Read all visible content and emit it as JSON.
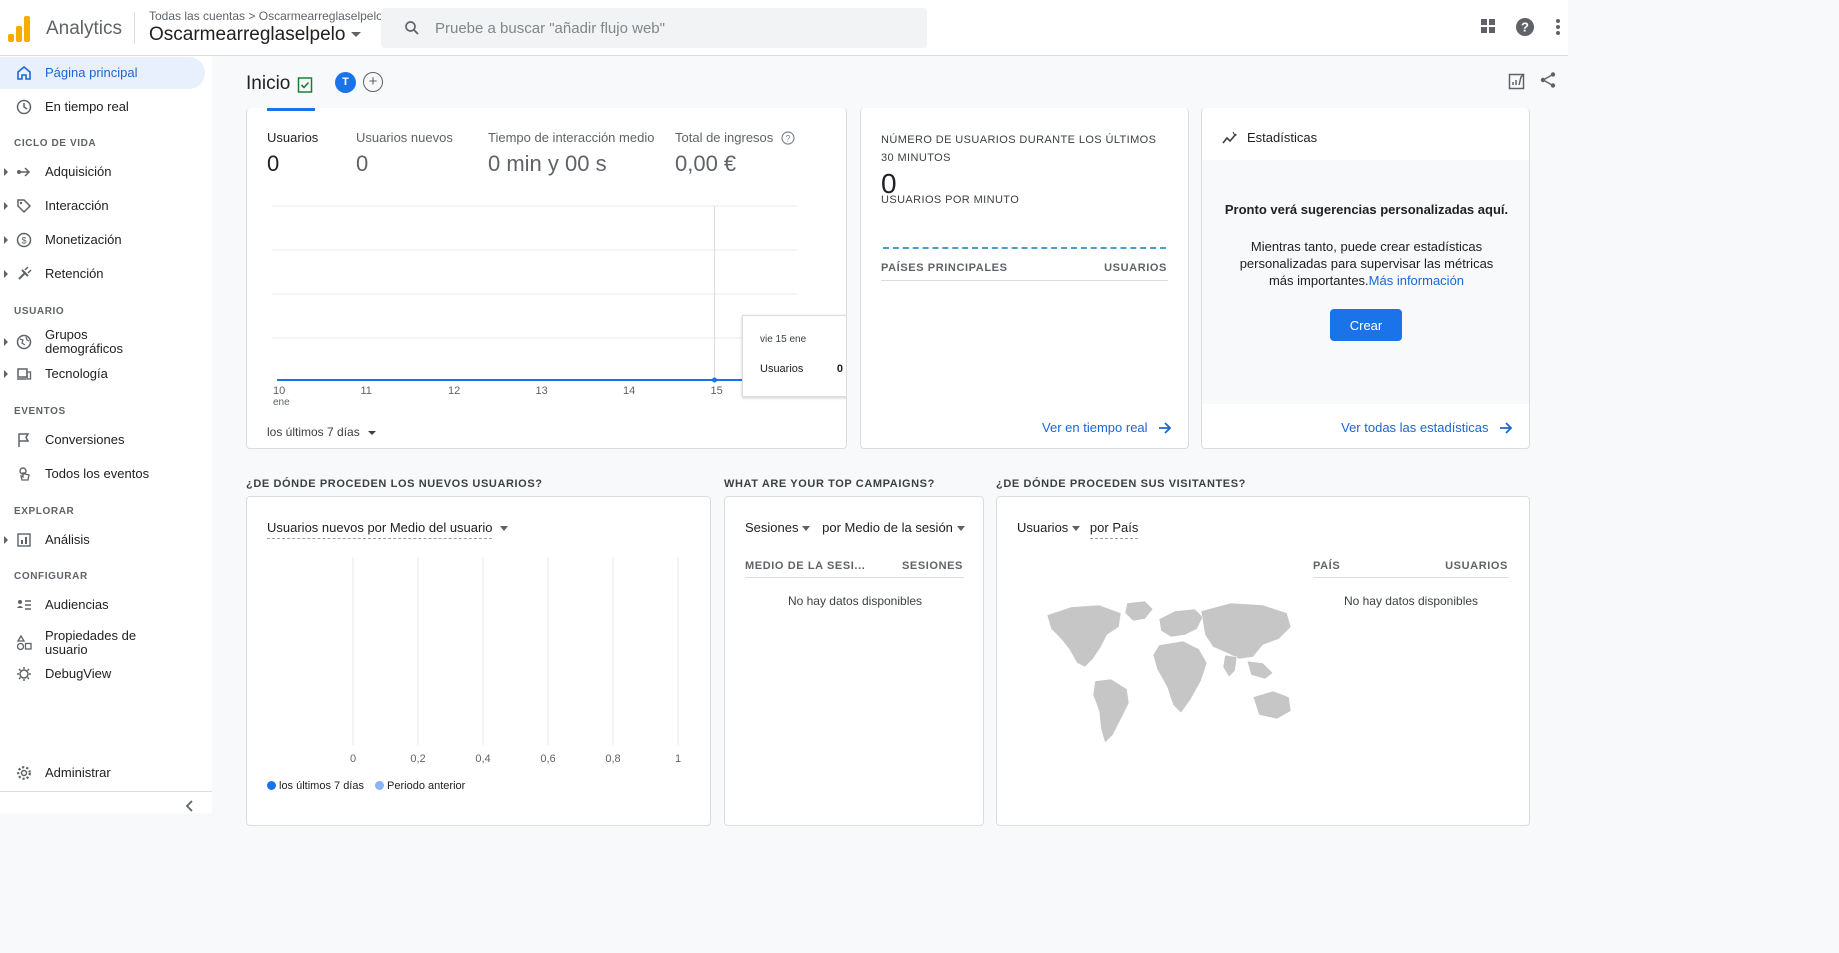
{
  "header": {
    "brand": "Analytics",
    "breadcrumb_root": "Todas las cuentas",
    "breadcrumb_sep": ">",
    "breadcrumb_account": "Oscarmearreglaselpelo",
    "property": "Oscarmearreglaselpelo",
    "search_placeholder": "Pruebe a buscar \"añadir flujo web\"",
    "logo_color": "#f9ab00"
  },
  "sidebar": {
    "top": [
      {
        "label": "Página principal",
        "icon": "home-icon",
        "active": true
      },
      {
        "label": "En tiempo real",
        "icon": "clock-icon"
      }
    ],
    "sections": [
      {
        "title": "CICLO DE VIDA",
        "items": [
          "Adquisición",
          "Interacción",
          "Monetización",
          "Retención"
        ]
      },
      {
        "title": "USUARIO",
        "items": [
          "Grupos demográficos",
          "Tecnología"
        ]
      },
      {
        "title": "EVENTOS",
        "items": [
          "Conversiones",
          "Todos los eventos"
        ]
      },
      {
        "title": "EXPLORAR",
        "items": [
          "Análisis"
        ]
      },
      {
        "title": "CONFIGURAR",
        "items": [
          "Audiencias",
          "Propiedades de usuario",
          "DebugView"
        ]
      }
    ],
    "admin": "Administrar"
  },
  "page": {
    "title": "Inicio",
    "avatar_letter": "T"
  },
  "overview": {
    "metrics": [
      {
        "label": "Usuarios",
        "value": "0"
      },
      {
        "label": "Usuarios nuevos",
        "value": "0"
      },
      {
        "label": "Tiempo de interacción medio",
        "value": "0 min y 00 s"
      },
      {
        "label": "Total de ingresos",
        "value": "0,00 €"
      }
    ],
    "date_range": "los últimos 7 días",
    "tooltip_date": "vie 15 ene",
    "tooltip_label": "Usuarios",
    "tooltip_value": "0"
  },
  "chart_data": [
    {
      "type": "line",
      "x": [
        "10",
        "11",
        "12",
        "13",
        "14",
        "15"
      ],
      "x_sublabel": "ene",
      "series": [
        {
          "name": "Usuarios",
          "values": [
            0,
            0,
            0,
            0,
            0,
            0
          ]
        }
      ],
      "color": "#1a73e8"
    },
    {
      "type": "bar",
      "x_ticks": [
        "0",
        "0,2",
        "0,4",
        "0,6",
        "0,8",
        "1"
      ],
      "series": [
        {
          "name": "los últimos 7 días",
          "values": []
        },
        {
          "name": "Periodo anterior",
          "values": []
        }
      ],
      "legend": "bottom"
    }
  ],
  "realtime": {
    "title_line1": "NÚMERO DE USUARIOS DURANTE LOS ÚLTIMOS",
    "title_line2": "30 MINUTOS",
    "value": "0",
    "sub": "USUARIOS POR MINUTO",
    "col_country": "PAÍSES PRINCIPALES",
    "col_users": "USUARIOS",
    "link": "Ver en tiempo real"
  },
  "insights": {
    "title": "Estadísticas",
    "heading": "Pronto verá sugerencias personalizadas aquí.",
    "body": "Mientras tanto, puede crear estadísticas personalizadas para supervisar las métricas más importantes.",
    "more_link": "Más información",
    "button": "Crear",
    "link": "Ver todas las estadísticas"
  },
  "new_users": {
    "section": "¿DE DÓNDE PROCEDEN LOS NUEVOS USUARIOS?",
    "selector": "Usuarios nuevos por Medio del usuario",
    "legend_current": "los últimos 7 días",
    "legend_previous": "Periodo anterior",
    "legend_current_color": "#1a73e8",
    "legend_previous_color": "#8ab4f8"
  },
  "campaigns": {
    "section": "WHAT ARE YOUR TOP CAMPAIGNS?",
    "metric": "Sesiones",
    "dimension": "por Medio de la sesión",
    "col1": "MEDIO DE LA SESI...",
    "col2": "SESIONES",
    "empty": "No hay datos disponibles"
  },
  "visitors": {
    "section": "¿DE DÓNDE PROCEDEN SUS VISITANTES?",
    "metric": "Usuarios",
    "dimension": "por País",
    "col1": "PAÍS",
    "col2": "USUARIOS",
    "empty": "No hay datos disponibles"
  }
}
